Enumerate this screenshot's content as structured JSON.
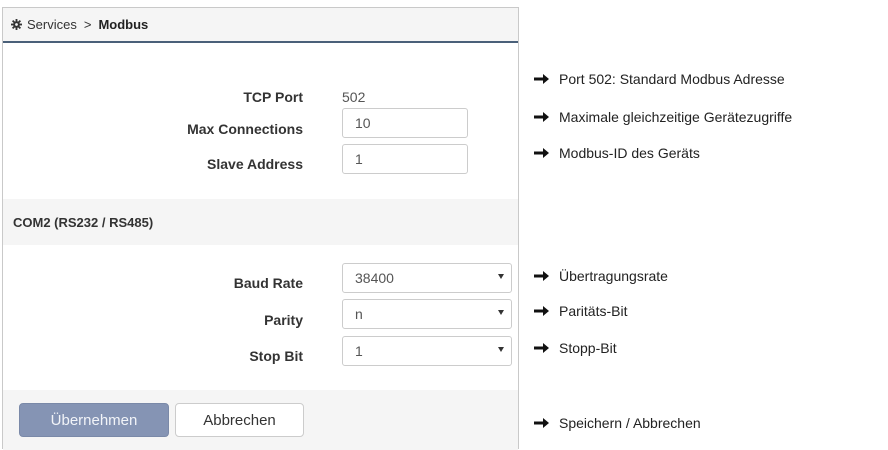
{
  "breadcrumb": {
    "parent": "Services",
    "separator": ">",
    "current": "Modbus"
  },
  "modbus": {
    "tcp_port_label": "TCP Port",
    "tcp_port_value": "502",
    "max_connections_label": "Max Connections",
    "max_connections_value": "10",
    "slave_address_label": "Slave Address",
    "slave_address_value": "1"
  },
  "com2": {
    "title": "COM2 (RS232 / RS485)",
    "baud_rate_label": "Baud Rate",
    "baud_rate_value": "38400",
    "parity_label": "Parity",
    "parity_value": "n",
    "stop_bit_label": "Stop Bit",
    "stop_bit_value": "1"
  },
  "footer": {
    "apply_label": "Übernehmen",
    "cancel_label": "Abbrechen"
  },
  "annotations": {
    "port": "Port 502: Standard Modbus Adresse",
    "max_connections": "Maximale gleichzeitige Gerätezugriffe",
    "slave_address": "Modbus-ID des Geräts",
    "baud_rate": "Übertragungsrate",
    "parity": "Paritäts-Bit",
    "stop_bit": "Stopp-Bit",
    "buttons": "Speichern / Abbrechen"
  },
  "icons": {
    "header": "gear-icon",
    "annotation": "arrow-right-icon"
  },
  "colors": {
    "header_border": "#4a6079",
    "primary_button": "#8594b4",
    "panel_bg": "#f5f5f5"
  }
}
